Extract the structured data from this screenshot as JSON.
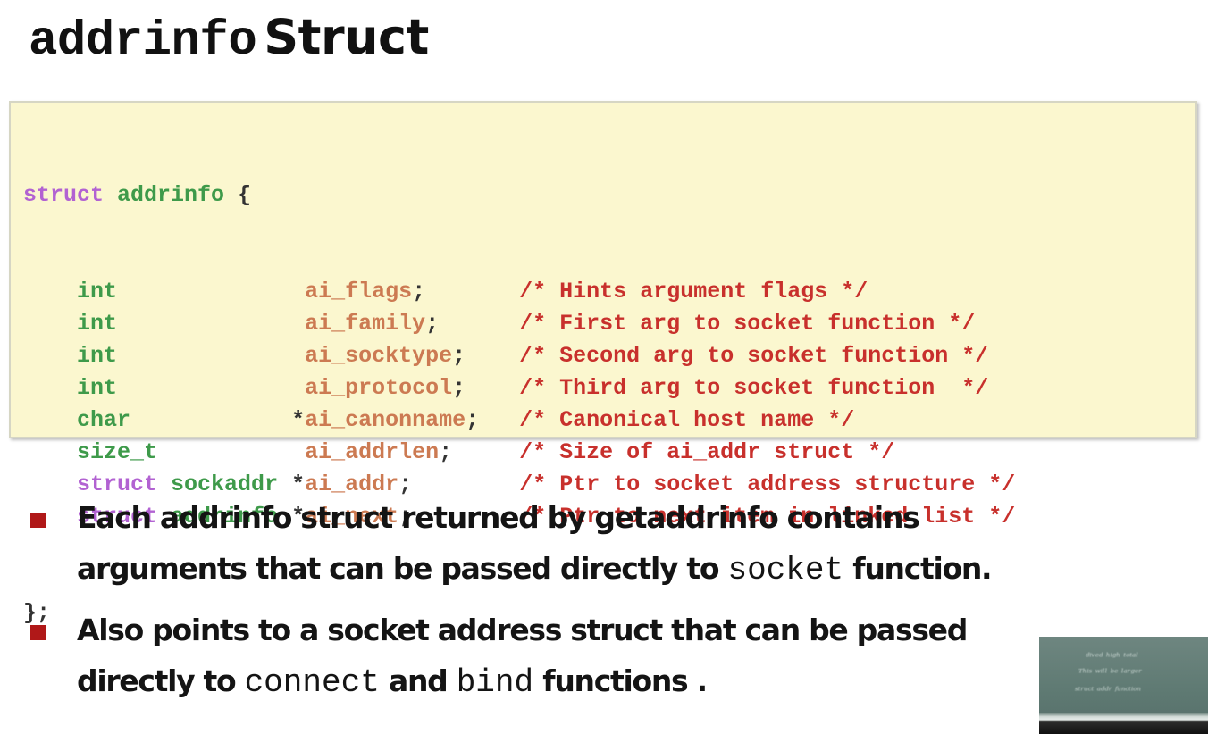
{
  "slide": {
    "title": {
      "code_part": "addrinfo",
      "text_part": "Struct"
    },
    "code_block": {
      "header": {
        "keyword": "struct",
        "name": "addrinfo",
        "brace": " {"
      },
      "fields": [
        {
          "type_kw": "",
          "type": "int",
          "ptr": " ",
          "name": "ai_flags",
          "semi": ";",
          "comment": "/* Hints argument flags */"
        },
        {
          "type_kw": "",
          "type": "int",
          "ptr": " ",
          "name": "ai_family",
          "semi": ";",
          "comment": "/* First arg to socket function */"
        },
        {
          "type_kw": "",
          "type": "int",
          "ptr": " ",
          "name": "ai_socktype",
          "semi": ";",
          "comment": "/* Second arg to socket function */"
        },
        {
          "type_kw": "",
          "type": "int",
          "ptr": " ",
          "name": "ai_protocol",
          "semi": ";",
          "comment": "/* Third arg to socket function  */"
        },
        {
          "type_kw": "",
          "type": "char",
          "ptr": "*",
          "name": "ai_canonname",
          "semi": ";",
          "comment": "/* Canonical host name */"
        },
        {
          "type_kw": "",
          "type": "size_t",
          "ptr": " ",
          "name": "ai_addrlen",
          "semi": ";",
          "comment": "/* Size of ai_addr struct */"
        },
        {
          "type_kw": "struct",
          "type": "sockaddr",
          "ptr": "*",
          "name": "ai_addr",
          "semi": ";",
          "comment": "/* Ptr to socket address structure */"
        },
        {
          "type_kw": "struct",
          "type": "addrinfo",
          "ptr": "*",
          "name": "ai_next",
          "semi": ";",
          "comment": "/* Ptr to next item in linked list */"
        }
      ],
      "footer": "};"
    },
    "bullets": [
      {
        "line1": "Each addrinfo struct returned by getaddrinfo contains",
        "line2_before": "arguments that can be passed directly to ",
        "line2_code": "socket",
        "line2_after": " function."
      },
      {
        "line1": "Also points to a socket address struct that can be passed",
        "line2_before": "directly to ",
        "line2_code1": "connect",
        "line2_mid": " and ",
        "line2_code2": "bind",
        "line2_after": "  functions ."
      }
    ],
    "colors": {
      "code_background": "#fbf7cf",
      "keyword": "#b262d2",
      "type": "#3e9a4a",
      "field": "#cc7a52",
      "comment": "#c8302c",
      "bullet_marker": "#b01818"
    }
  },
  "video_overlay": {
    "description": "lecturer camera inset showing chalkboard"
  }
}
